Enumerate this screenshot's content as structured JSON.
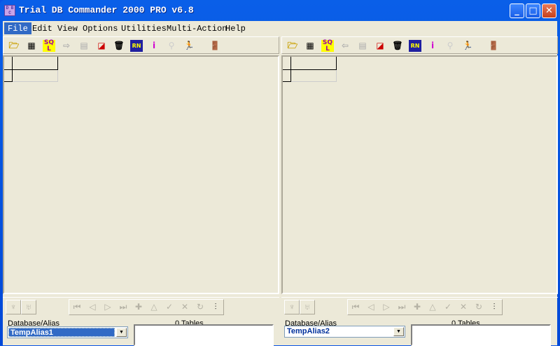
{
  "window": {
    "title": "Trial DB Commander 2000 PRO v6.8",
    "app_icon": "DBC",
    "controls": [
      "minimize",
      "maximize",
      "close"
    ]
  },
  "menu": [
    "File",
    "Edit",
    "View",
    "Options",
    "Utilities",
    "Multi-Action",
    "Help"
  ],
  "toolbar_icons": [
    "open-folder",
    "table-grid",
    "sql",
    "arrow",
    "copy-arrow",
    "filter-edit",
    "trash",
    "report",
    "info",
    "search-disabled",
    "run-man",
    "exit-door"
  ],
  "panes": [
    {
      "db_label": "Database/Alias",
      "alias": "TempAlias1",
      "tables_count": "0 Tables"
    },
    {
      "db_label": "Database/Alias",
      "alias": "TempAlias2",
      "tables_count": "0 Tables"
    }
  ]
}
